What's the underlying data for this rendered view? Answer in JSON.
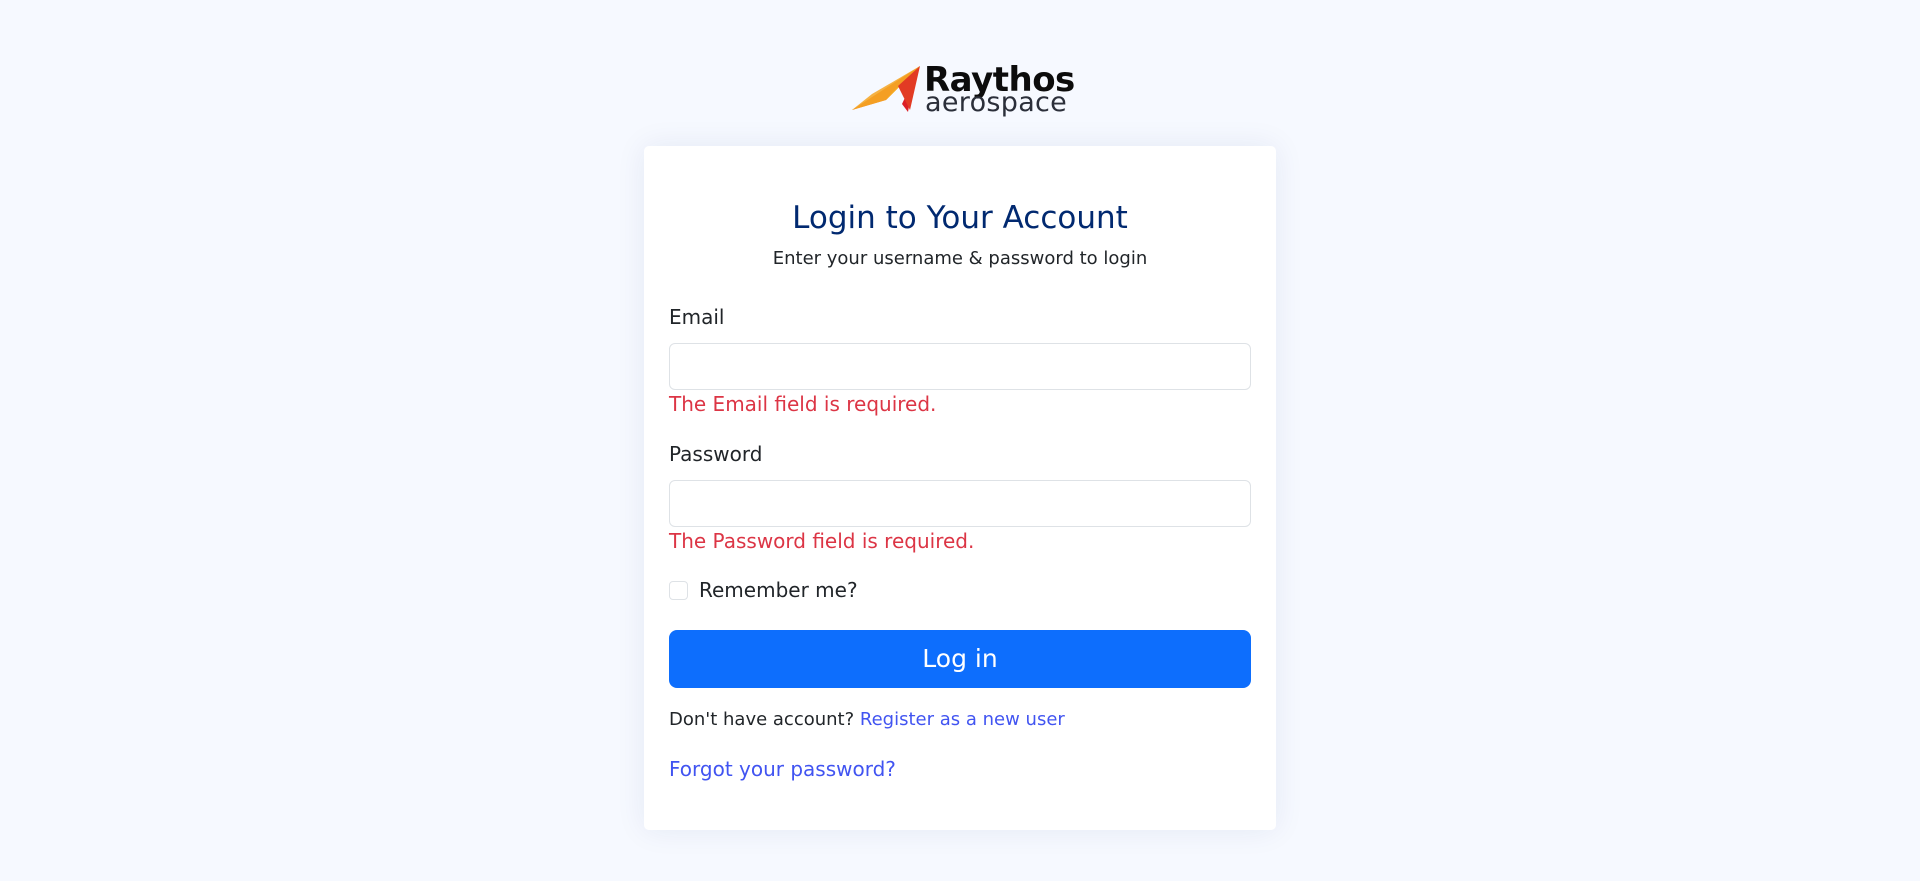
{
  "brand": {
    "name": "Raythos",
    "tagline": "aerospace",
    "colors": {
      "plane_yellow": "#f7c21d",
      "plane_orange": "#f17a22",
      "plane_red": "#dc1f26"
    }
  },
  "login": {
    "title": "Login to Your Account",
    "subtitle": "Enter your username & password to login",
    "email": {
      "label": "Email",
      "value": "",
      "error": "The Email field is required."
    },
    "password": {
      "label": "Password",
      "value": "",
      "error": "The Password field is required."
    },
    "remember": {
      "label": "Remember me?",
      "checked": false
    },
    "submit_label": "Log in",
    "register_prompt": "Don't have account?",
    "register_link": "Register as a new user",
    "forgot_link": "Forgot your password?"
  },
  "colors": {
    "page_background": "#f6f9ff",
    "title": "#012970",
    "error": "#dc3545",
    "primary_button": "#0d6efd",
    "link": "#4154f1"
  }
}
